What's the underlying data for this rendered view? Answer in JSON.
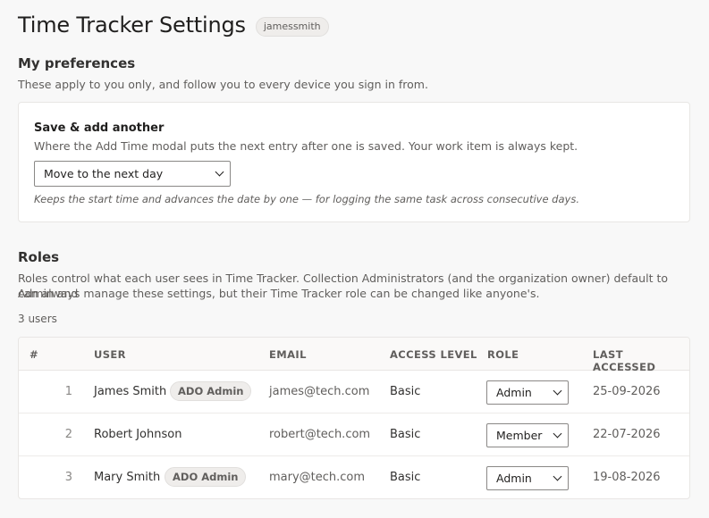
{
  "header": {
    "title": "Time Tracker Settings",
    "username": "jamessmith"
  },
  "preferences": {
    "heading": "My preferences",
    "description": "These apply to you only, and follow you to every device you sign in from.",
    "save_and_add": {
      "title": "Save & add another",
      "description": "Where the Add Time modal puts the next entry after one is saved. Your work item is always kept.",
      "selected_option": "Move to the next day",
      "hint": "Keeps the start time and advances the date by one — for logging the same task across consecutive days."
    }
  },
  "roles": {
    "heading": "Roles",
    "description_line1": "Roles control what each user sees in Time Tracker. Collection Administrators (and the organization owner) default to Admin and",
    "description_line2": "can always manage these settings, but their Time Tracker role can be changed like anyone's.",
    "user_count": "3 users",
    "columns": {
      "index": "#",
      "user": "USER",
      "email": "EMAIL",
      "access_level": "ACCESS LEVEL",
      "role": "ROLE",
      "last_accessed": "LAST ACCESSED"
    },
    "rows": [
      {
        "index": "1",
        "user": "James Smith",
        "badge": "ADO Admin",
        "email": "james@tech.com",
        "access_level": "Basic",
        "role": "Admin",
        "last_accessed": "25-09-2026"
      },
      {
        "index": "2",
        "user": "Robert Johnson",
        "badge": "",
        "email": "robert@tech.com",
        "access_level": "Basic",
        "role": "Member",
        "last_accessed": "22-07-2026"
      },
      {
        "index": "3",
        "user": "Mary Smith",
        "badge": "ADO Admin",
        "email": "mary@tech.com",
        "access_level": "Basic",
        "role": "Admin",
        "last_accessed": "19-08-2026"
      }
    ]
  },
  "icons": {
    "dropdown": "chevron-down-icon"
  },
  "colors": {
    "background": "#f8f8f8",
    "card": "#ffffff",
    "text": "#323130",
    "muted_text": "#605e5c",
    "badge_bg": "#efedeb"
  }
}
